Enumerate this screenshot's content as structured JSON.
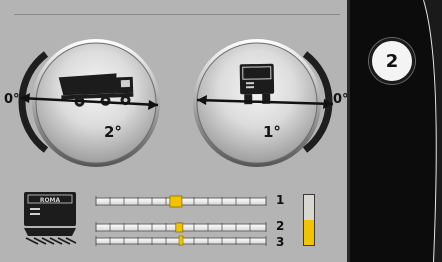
{
  "gauges": {
    "left": {
      "edge_label": "0°",
      "value_label": "2°",
      "icon": "dump-truck-icon"
    },
    "right": {
      "edge_label": "0°",
      "value_label": "1°",
      "icon": "roma-machine-icon"
    }
  },
  "sliders": [
    {
      "label": "1",
      "position": 0.47
    },
    {
      "label": "2",
      "position": 0.49
    },
    {
      "label": "3",
      "position": 0.5
    }
  ],
  "vertical_level": {
    "fraction": 0.5,
    "color": "#f2c400"
  },
  "machine_icon": {
    "name": "roma-paver-icon",
    "brand_text": "ROMA"
  },
  "side_panel": {
    "step_number": "2"
  },
  "colors": {
    "screen": "#b4b4b4",
    "slider_thumb": "#f2c400",
    "panel": "#0c0c0c"
  }
}
